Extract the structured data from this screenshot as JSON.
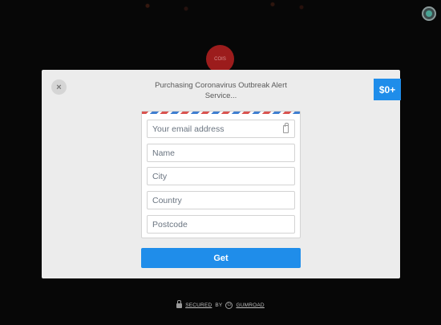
{
  "header": {
    "seller_logo_text": "COIS"
  },
  "modal": {
    "close_glyph": "×",
    "title": "Purchasing Coronavirus Outbreak Alert Service...",
    "price": "$0+"
  },
  "form": {
    "email_placeholder": "Your email address",
    "name_placeholder": "Name",
    "city_placeholder": "City",
    "country_placeholder": "Country",
    "postcode_placeholder": "Postcode",
    "submit_label": "Get"
  },
  "footer": {
    "secured_label": "SECURED",
    "by_label": "BY",
    "provider": "GUMROAD"
  },
  "colors": {
    "accent": "#1f8dea",
    "modal_bg": "#ececec",
    "page_bg": "#070707"
  },
  "icons": [
    "user-avatar-icon",
    "close-icon",
    "key-icon",
    "lock-icon",
    "gumroad-icon"
  ]
}
